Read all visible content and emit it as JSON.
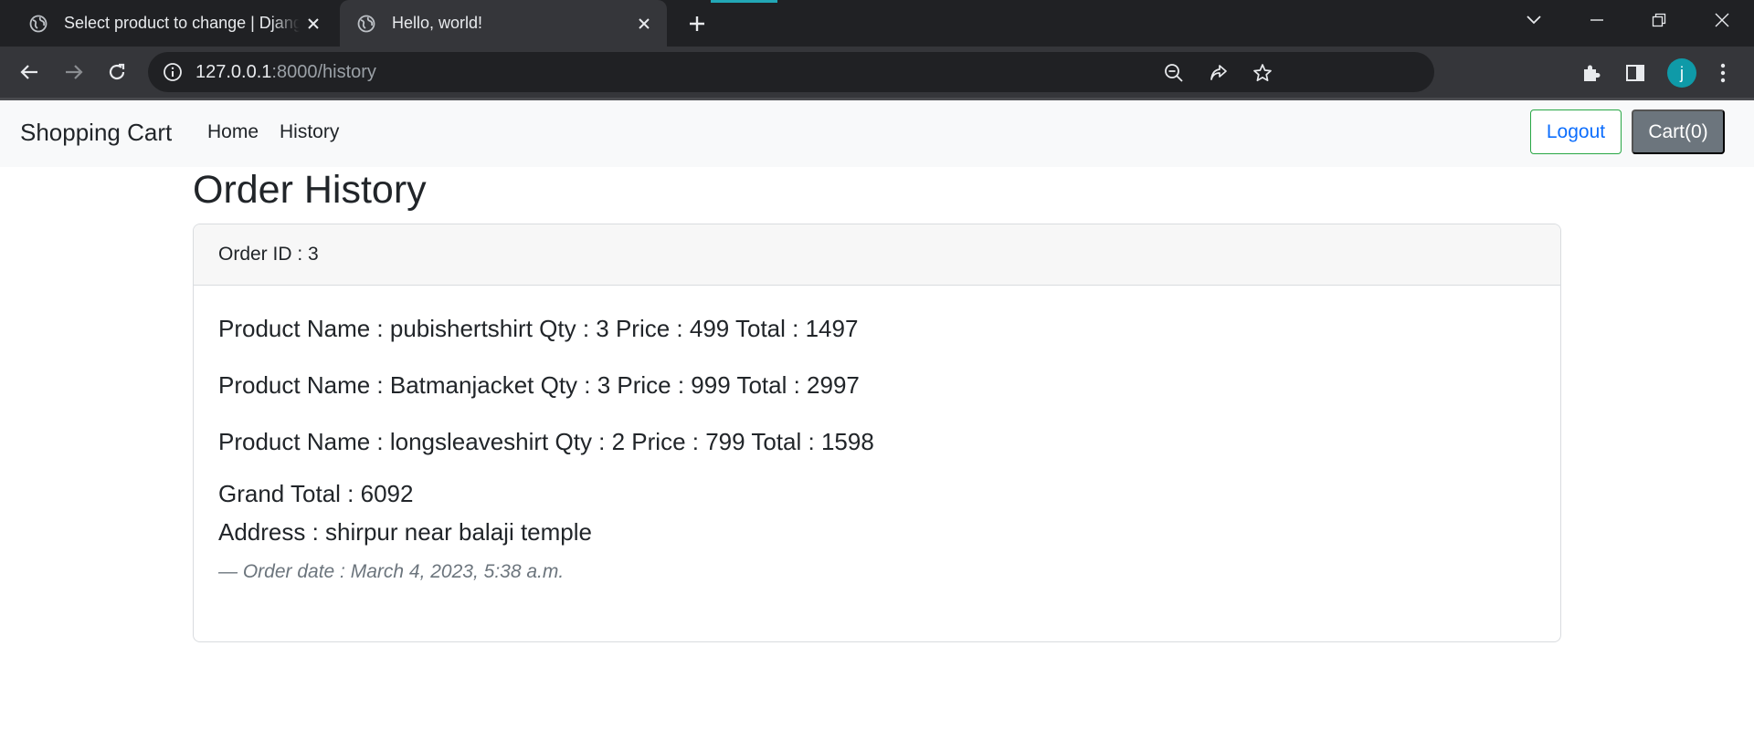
{
  "browser": {
    "tabs": [
      {
        "title": "Select product to change | Django site admin",
        "active": false
      },
      {
        "title": "Hello, world!",
        "active": true
      }
    ],
    "address": {
      "host": "127.0.0.1",
      "rest": ":8000/history"
    },
    "avatar_letter": "j",
    "accent_color": "#22a7b6"
  },
  "navbar": {
    "brand": "Shopping Cart",
    "links": [
      "Home",
      "History"
    ],
    "logout_label": "Logout",
    "cart_label": "Cart(0)"
  },
  "page": {
    "title": "Order History",
    "orders": [
      {
        "header": "Order ID : 3",
        "items": [
          "Product Name : pubishertshirt Qty : 3 Price : 499 Total : 1497",
          "Product Name : Batmanjacket Qty : 3 Price : 999 Total : 2997",
          "Product Name : longsleaveshirt Qty : 2 Price : 799 Total : 1598"
        ],
        "grand_total": "Grand Total : 6092",
        "address": "Address : shirpur near balaji temple",
        "order_date": "— Order date : March 4, 2023, 5:38 a.m."
      }
    ]
  }
}
